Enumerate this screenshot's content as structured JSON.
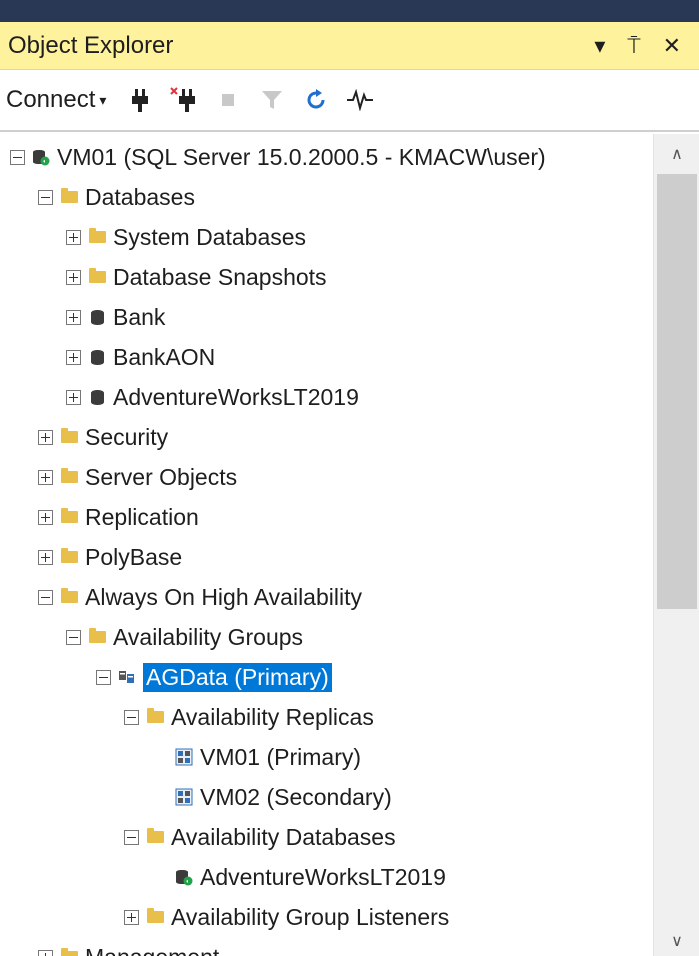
{
  "panel": {
    "title": "Object Explorer",
    "dropdown_icon": "▾",
    "pin_icon": "⍑",
    "close_icon": "✕"
  },
  "toolbar": {
    "connect_label": "Connect",
    "connect_caret": "▾"
  },
  "tree": {
    "items": [
      {
        "label": "VM01 (SQL Server 15.0.2000.5 - KMACW\\user)",
        "icon": "server-icon",
        "expander": "minus"
      },
      {
        "label": "Databases",
        "icon": "folder-icon",
        "expander": "minus"
      },
      {
        "label": "System Databases",
        "icon": "folder-icon",
        "expander": "plus"
      },
      {
        "label": "Database Snapshots",
        "icon": "folder-icon",
        "expander": "plus"
      },
      {
        "label": "Bank",
        "icon": "database-icon",
        "expander": "plus"
      },
      {
        "label": "BankAON",
        "icon": "database-icon",
        "expander": "plus"
      },
      {
        "label": "AdventureWorksLT2019",
        "icon": "database-icon",
        "expander": "plus"
      },
      {
        "label": "Security",
        "icon": "folder-icon",
        "expander": "plus"
      },
      {
        "label": "Server Objects",
        "icon": "folder-icon",
        "expander": "plus"
      },
      {
        "label": "Replication",
        "icon": "folder-icon",
        "expander": "plus"
      },
      {
        "label": "PolyBase",
        "icon": "folder-icon",
        "expander": "plus"
      },
      {
        "label": "Always On High Availability",
        "icon": "folder-icon",
        "expander": "minus"
      },
      {
        "label": "Availability Groups",
        "icon": "folder-icon",
        "expander": "minus"
      },
      {
        "label": "AGData (Primary)",
        "icon": "availability-group-icon",
        "expander": "minus",
        "selected": true
      },
      {
        "label": "Availability Replicas",
        "icon": "folder-icon",
        "expander": "minus"
      },
      {
        "label": "VM01 (Primary)",
        "icon": "replica-icon",
        "expander": "none"
      },
      {
        "label": "VM02 (Secondary)",
        "icon": "replica-icon",
        "expander": "none"
      },
      {
        "label": "Availability Databases",
        "icon": "folder-icon",
        "expander": "minus"
      },
      {
        "label": "AdventureWorksLT2019",
        "icon": "synced-database-icon",
        "expander": "none"
      },
      {
        "label": "Availability Group Listeners",
        "icon": "folder-icon",
        "expander": "plus"
      },
      {
        "label": "Management",
        "icon": "folder-icon",
        "expander": "plus"
      }
    ]
  },
  "scrollbar": {
    "up_arrow": "∧",
    "down_arrow": "∨"
  },
  "colors": {
    "title_bar": "#fff29d",
    "selection": "#0078d7",
    "folder": "#e8bf4b",
    "top_bar": "#293955"
  }
}
